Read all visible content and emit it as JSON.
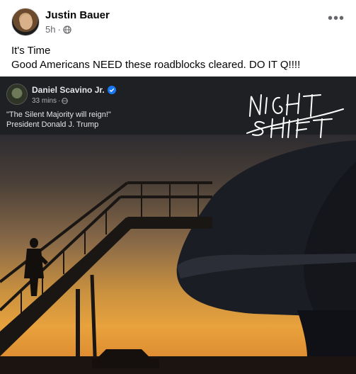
{
  "post": {
    "author": "Justin Bauer",
    "time": "5h",
    "separator": "·",
    "more_label": "•••",
    "lines": [
      "It's Time",
      "Good Americans NEED these roadblocks cleared. DO IT Q!!!!"
    ]
  },
  "shared_image": {
    "embed_author": "Daniel Scavino Jr.",
    "embed_time": "33 mins",
    "embed_separator": "·",
    "quote": "\"The Silent Majority will reign!\"",
    "attribution": "President Donald J. Trump",
    "signature_text": "NIGHT SHIFT"
  },
  "colors": {
    "name_text": "#050505",
    "meta_text": "#65676b",
    "embed_bar": "#1f2023",
    "sunset_orange": "#e8a23d"
  },
  "icons": [
    "globe-icon",
    "more-options-icon",
    "verified-badge-icon"
  ]
}
